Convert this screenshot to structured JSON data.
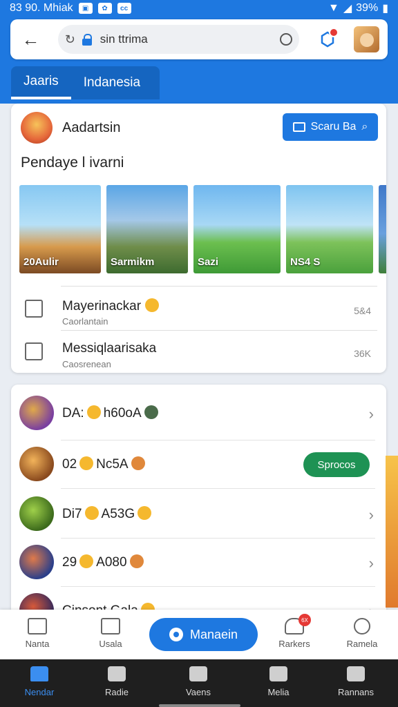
{
  "status_bar": {
    "time": "83 90. Mhiak",
    "battery": "39%",
    "icons": [
      "notification-icon",
      "app-icon",
      "cc-icon",
      "wifi-icon",
      "signal-icon",
      "battery-icon"
    ]
  },
  "browser": {
    "url": "sin ttrima",
    "back_icon": "arrow-left-icon"
  },
  "tabs": [
    {
      "label": "Jaaris"
    },
    {
      "label": "Indanesia"
    }
  ],
  "card1": {
    "publisher": "Aadartsin",
    "search_button": "Scaru Ba",
    "section_title": "Pendaye l ivarni",
    "thumbs": [
      {
        "label": "20Aulir"
      },
      {
        "label": "Sarmikm"
      },
      {
        "label": "Sazi"
      },
      {
        "label": "NS4 S"
      }
    ],
    "rows": [
      {
        "title": "Mayerinackar",
        "sub": "Caorlantain",
        "value": "5&4"
      },
      {
        "title": "Messiqlaarisaka",
        "sub": "Caosrenean",
        "value": "36K"
      }
    ]
  },
  "games": [
    {
      "title_a": "DA:",
      "title_b": "h60oA",
      "action": "chevron"
    },
    {
      "title_a": "02",
      "title_b": "Nc5A",
      "action": "button",
      "button_label": "Sprocos"
    },
    {
      "title_a": "Di7",
      "title_b": "A53G",
      "action": "chevron"
    },
    {
      "title_a": "29",
      "title_b": "A080",
      "action": "chevron"
    },
    {
      "title_a": "Cinsont",
      "title_b": "Gala",
      "action": "chevron"
    }
  ],
  "bottom_nav": {
    "items": [
      {
        "label": "Nanta"
      },
      {
        "label": "Usala"
      },
      {
        "label": "Rarkers",
        "badge": "6X"
      },
      {
        "label": "Ramela"
      }
    ],
    "fab_label": "Manaein"
  },
  "system_nav": {
    "items": [
      {
        "label": "Nendar",
        "active": true
      },
      {
        "label": "Radie",
        "active": false
      },
      {
        "label": "Vaens",
        "active": false
      },
      {
        "label": "Melia",
        "active": false
      },
      {
        "label": "Rannans",
        "active": false
      }
    ]
  },
  "colors": {
    "brand_blue": "#1e78e0",
    "play_green": "#1e9254",
    "badge_red": "#e53935"
  }
}
